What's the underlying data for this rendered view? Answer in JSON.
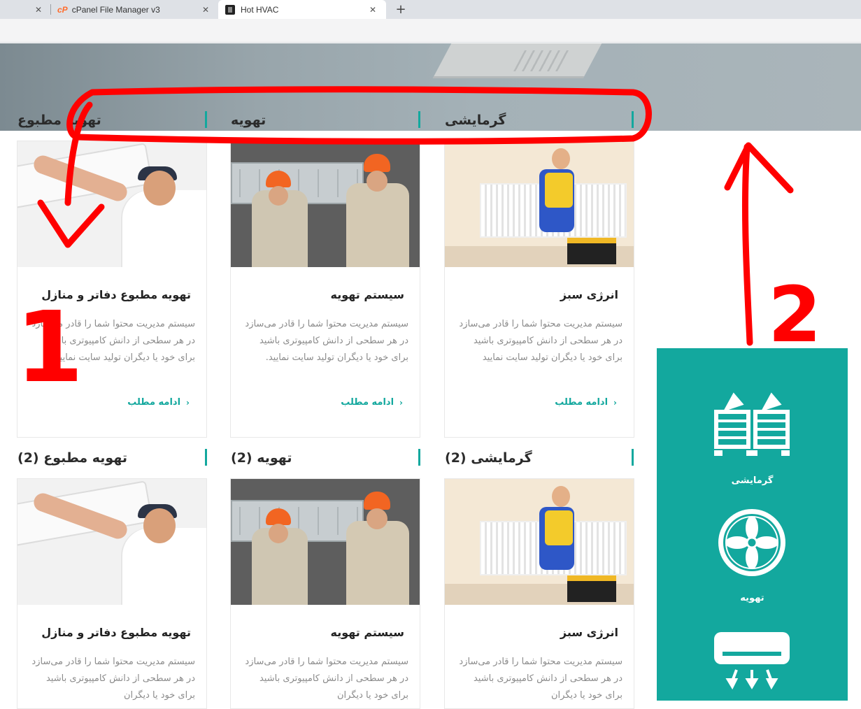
{
  "browser": {
    "tabs": [
      {
        "title": ""
      },
      {
        "title": "cPanel File Manager v3",
        "logo": "cP"
      },
      {
        "title": "Hot HVAC",
        "active": true
      }
    ],
    "close_glyph": "✕",
    "newtab_glyph": "+"
  },
  "sections": [
    {
      "heading": "گرمایشی",
      "card": {
        "title": "انرژی سبز",
        "text": "سیستم مدیریت محتوا شما را قادر می‌سازد در هر سطحی از دانش کامپیوتری باشید برای خود یا دیگران تولید سایت نمایید",
        "more": "ادامه مطلب",
        "image": "radiator-worker"
      }
    },
    {
      "heading": "تهویه",
      "card": {
        "title": "سیستم تهویه",
        "text": "سیستم مدیریت محتوا شما را قادر می‌سازد در هر سطحی از دانش کامپیوتری باشید برای خود یا دیگران تولید سایت نمایید.",
        "more": "ادامه مطلب",
        "image": "duct-workers"
      }
    },
    {
      "heading": "تهویه مطبوع",
      "card": {
        "title": "تهویه مطبوع دفاتر و منازل",
        "text": "سیستم مدیریت محتوا شما را قادر می‌سازد در هر سطحی از دانش کامپیوتری باشید برای خود یا دیگران تولید سایت نمایید",
        "more": "ادامه مطلب",
        "image": "ac-installer"
      }
    },
    {
      "heading": "گرمایشی (2)",
      "card": {
        "title": "انرژی سبز",
        "text": "سیستم مدیریت محتوا شما را قادر می‌سازد در هر سطحی از دانش کامپیوتری باشید برای خود یا دیگران",
        "image": "radiator-worker"
      }
    },
    {
      "heading": "تهویه (2)",
      "card": {
        "title": "سیستم تهویه",
        "text": "سیستم مدیریت محتوا شما را قادر می‌سازد در هر سطحی از دانش کامپیوتری باشید برای خود یا دیگران",
        "image": "duct-workers"
      }
    },
    {
      "heading": "تهویه مطبوع (2)",
      "card": {
        "title": "تهویه مطبوع دفاتر و منازل",
        "text": "سیستم مدیریت محتوا شما را قادر می‌سازد در هر سطحی از دانش کامپیوتری باشید برای خود یا دیگران",
        "image": "ac-installer"
      }
    }
  ],
  "sidebar": {
    "items": [
      {
        "label": "گرمایشی",
        "icon": "heating-unit-icon"
      },
      {
        "label": "تهویه",
        "icon": "ventilation-fan-icon"
      },
      {
        "label": "",
        "icon": "air-conditioner-icon"
      }
    ]
  },
  "annotations": {
    "marks": [
      "1",
      "2"
    ]
  },
  "colors": {
    "accent": "#13a89e",
    "annotation": "#ff0000",
    "chrome": "#dee1e6"
  },
  "icons": {
    "more": "chevron-left-icon",
    "tab_close": "close-icon",
    "new_tab": "plus-icon"
  }
}
